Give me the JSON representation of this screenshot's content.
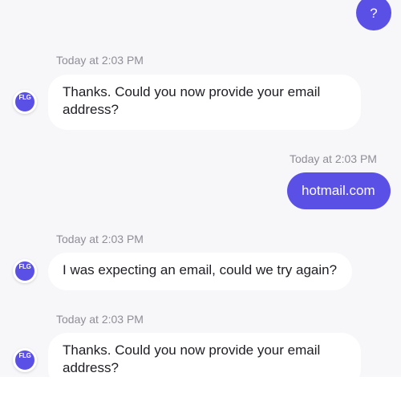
{
  "colors": {
    "accent": "#5b50e6",
    "background": "#f7f7f9",
    "incoming_bubble": "#ffffff",
    "timestamp_text": "#8e8e96"
  },
  "help_button": {
    "label": "?"
  },
  "messages": [
    {
      "sender": "bot",
      "avatar_label": "FLG",
      "timestamp": "Today at 2:03 PM",
      "text": "Thanks. Could you now provide your email address?"
    },
    {
      "sender": "user",
      "timestamp": "Today at 2:03 PM",
      "text": "hotmail.com"
    },
    {
      "sender": "bot",
      "avatar_label": "FLG",
      "timestamp": "Today at 2:03 PM",
      "text": "I was expecting an email, could we try again?"
    },
    {
      "sender": "bot",
      "avatar_label": "FLG",
      "timestamp": "Today at 2:03 PM",
      "text": "Thanks. Could you now provide your email address?"
    }
  ]
}
